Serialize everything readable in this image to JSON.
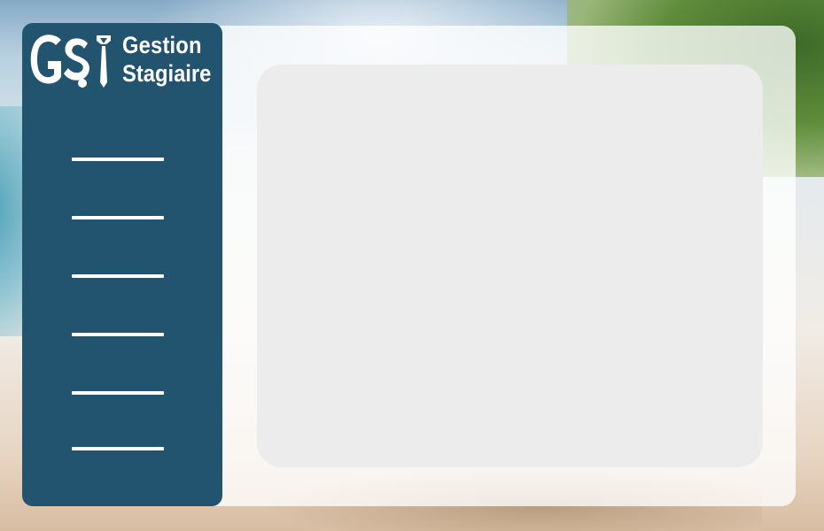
{
  "app": {
    "logo_monogram": "GS",
    "title_line1": "Gestion",
    "title_line2": "Stagiaire"
  },
  "sidebar": {
    "nav_items": [
      "",
      "",
      "",
      "",
      "",
      ""
    ]
  },
  "colors": {
    "sidebar": "#22536f",
    "content_box": "#ececec",
    "panel": "#ffffff",
    "nav_line": "#ffffff"
  },
  "icons": {
    "logo": "gs-briefcase-tie-logo"
  }
}
